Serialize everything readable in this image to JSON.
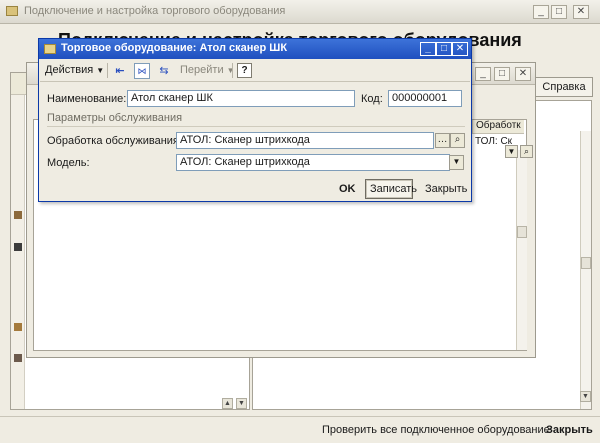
{
  "back_window": {
    "title": "Подключение и настройка торгового оборудования",
    "heading_partial": "Подключение и настройка торгового оборудования",
    "help_label": "Справка",
    "column_header": "Обработк",
    "column_value": "ТОЛ: Ск",
    "status_check_all": "Проверить все подключенное оборудование",
    "status_close": "Закрыть"
  },
  "dialog": {
    "title": "Торговое оборудование: Атол сканер ШК",
    "toolbar": {
      "actions_label": "Действия",
      "goto_label": "Перейти"
    },
    "name_label": "Наименование:",
    "name_value": "Атол сканер ШК",
    "code_label": "Код:",
    "code_value": "000000001",
    "section_title": "Параметры обслуживания",
    "processing_label": "Обработка обслуживания:",
    "processing_value": "АТОЛ: Сканер штрихкода",
    "model_label": "Модель:",
    "model_value": "АТОЛ: Сканер штрихкода",
    "ok_label": "OK",
    "save_label": "Записать",
    "close_label": "Закрыть"
  }
}
